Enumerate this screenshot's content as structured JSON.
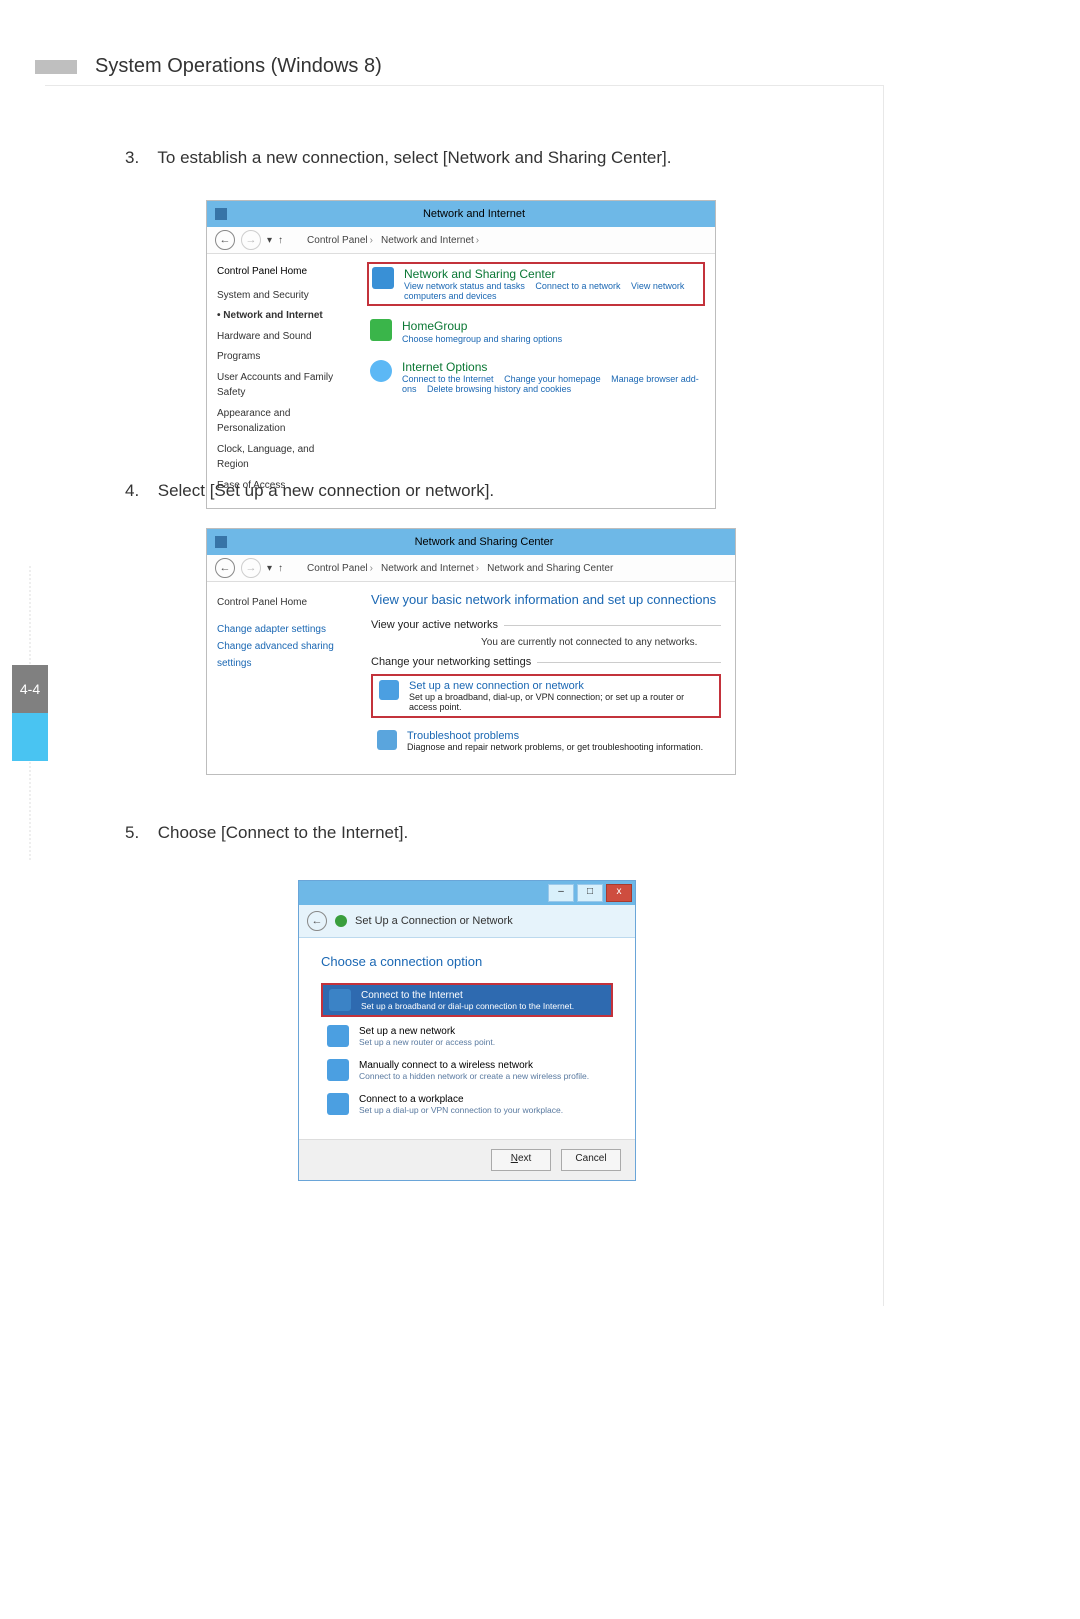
{
  "header": {
    "title": "System Operations (Windows 8)"
  },
  "page_tab": "4-4",
  "steps": {
    "s3_num": "3.",
    "s3_text": "To establish a new connection, select [Network and Sharing Center].",
    "s4_num": "4.",
    "s4_text": "Select [Set up a new connection or network].",
    "s5_num": "5.",
    "s5_text": "Choose [Connect to the Internet]."
  },
  "shot1": {
    "title_center": "Network and Internet",
    "breadcrumb": [
      "Control Panel",
      "Network and Internet"
    ],
    "side": {
      "home": "Control Panel Home",
      "items": [
        "System and Security",
        "Network and Internet",
        "Hardware and Sound",
        "Programs",
        "User Accounts and Family Safety",
        "Appearance and Personalization",
        "Clock, Language, and Region",
        "Ease of Access"
      ]
    },
    "cats": [
      {
        "title": "Network and Sharing Center",
        "links": [
          "View network status and tasks",
          "Connect to a network",
          "View network computers and devices"
        ]
      },
      {
        "title": "HomeGroup",
        "links": [
          "Choose homegroup and sharing options"
        ]
      },
      {
        "title": "Internet Options",
        "links": [
          "Connect to the Internet",
          "Change your homepage",
          "Manage browser add-ons",
          "Delete browsing history and cookies"
        ]
      }
    ]
  },
  "shot2": {
    "title_center": "Network and Sharing Center",
    "breadcrumb": [
      "Control Panel",
      "Network and Internet",
      "Network and Sharing Center"
    ],
    "side": {
      "home": "Control Panel Home",
      "link1": "Change adapter settings",
      "link2": "Change advanced sharing settings"
    },
    "main": {
      "heading": "View your basic network information and set up connections",
      "sect1": "View your active networks",
      "sect1_sub": "You are currently not connected to any networks.",
      "sect2": "Change your networking settings",
      "opt1": {
        "t": "Set up a new connection or network",
        "s": "Set up a broadband, dial-up, or VPN connection; or set up a router or access point."
      },
      "opt2": {
        "t": "Troubleshoot problems",
        "s": "Diagnose and repair network problems, or get troubleshooting information."
      }
    }
  },
  "shot3": {
    "bar_title": "Set Up a Connection or Network",
    "heading": "Choose a connection option",
    "opts": [
      {
        "t": "Connect to the Internet",
        "s": "Set up a broadband or dial-up connection to the Internet."
      },
      {
        "t": "Set up a new network",
        "s": "Set up a new router or access point."
      },
      {
        "t": "Manually connect to a wireless network",
        "s": "Connect to a hidden network or create a new wireless profile."
      },
      {
        "t": "Connect to a workplace",
        "s": "Set up a dial-up or VPN connection to your workplace."
      }
    ],
    "btn_next": "Next",
    "btn_cancel": "Cancel"
  }
}
